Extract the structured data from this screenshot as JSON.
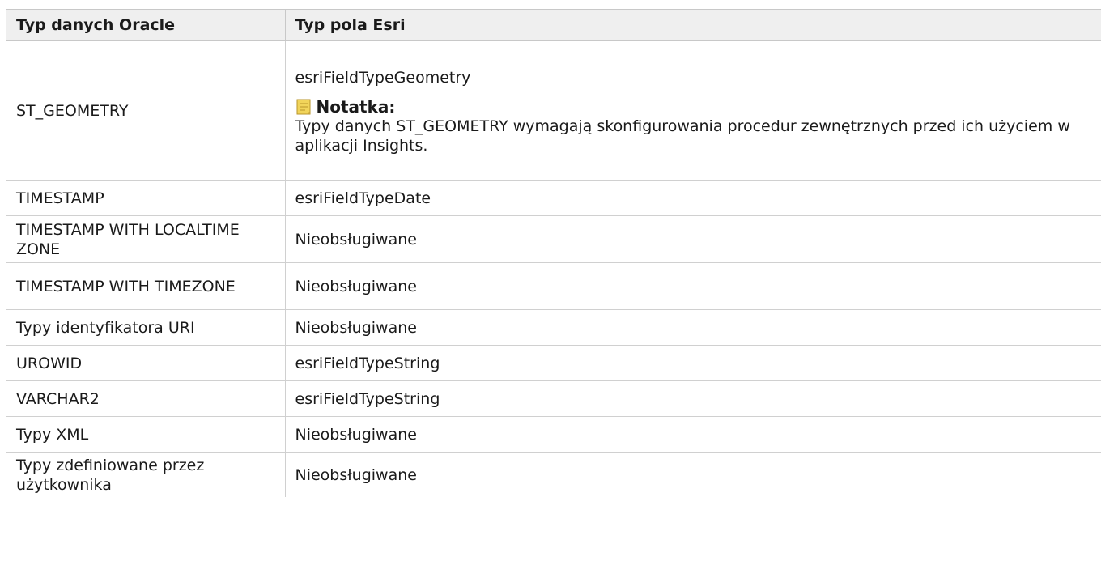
{
  "table": {
    "headers": [
      "Typ danych Oracle",
      "Typ pola Esri"
    ],
    "geometry_row": {
      "oracle": "ST_GEOMETRY",
      "esri": "esriFieldTypeGeometry",
      "note_label": "Notatka:",
      "note_text": "Typy danych ST_GEOMETRY wymagają skonfigurowania procedur zewnętrznych przed ich użyciem w aplikacji Insights."
    },
    "rows": [
      {
        "oracle": "TIMESTAMP",
        "esri": "esriFieldTypeDate"
      },
      {
        "oracle": "TIMESTAMP WITH LOCALTIME ZONE",
        "esri": "Nieobsługiwane"
      },
      {
        "oracle": "TIMESTAMP WITH TIMEZONE",
        "esri": "Nieobsługiwane"
      },
      {
        "oracle": "Typy identyfikatora URI",
        "esri": "Nieobsługiwane"
      },
      {
        "oracle": "UROWID",
        "esri": "esriFieldTypeString"
      },
      {
        "oracle": "VARCHAR2",
        "esri": "esriFieldTypeString"
      },
      {
        "oracle": "Typy XML",
        "esri": "Nieobsługiwane"
      },
      {
        "oracle": "Typy zdefiniowane przez użytkownika",
        "esri": "Nieobsługiwane"
      }
    ]
  },
  "icons": {
    "note": "note-icon"
  },
  "colors": {
    "header_bg": "#efefef",
    "note_icon": "#e8c33c"
  }
}
